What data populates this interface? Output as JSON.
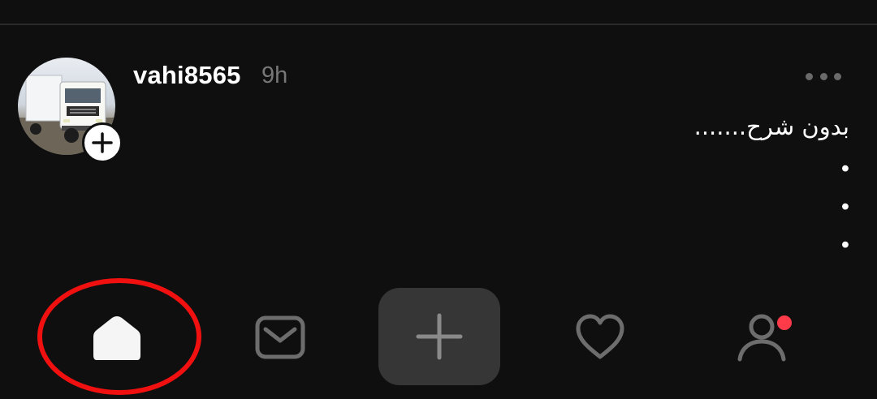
{
  "post": {
    "username": "vahi8565",
    "time": "9h",
    "caption": "بدون شرح.......",
    "bullets": [
      "•",
      "•",
      "•"
    ]
  },
  "icons": {
    "avatar": "truck-avatar-image",
    "follow": "plus-icon",
    "more": "more-horizontal-icon"
  },
  "nav": {
    "items": [
      "home-icon",
      "mail-icon",
      "create-plus-icon",
      "heart-icon",
      "profile-icon"
    ],
    "active": "home",
    "notification_dot": true
  },
  "colors": {
    "background": "#0f0f0f",
    "muted": "#777777",
    "nav_icon": "#6d6d6d",
    "create_button": "#363636",
    "notification": "#ff3b4a",
    "highlight": "#f01010"
  }
}
